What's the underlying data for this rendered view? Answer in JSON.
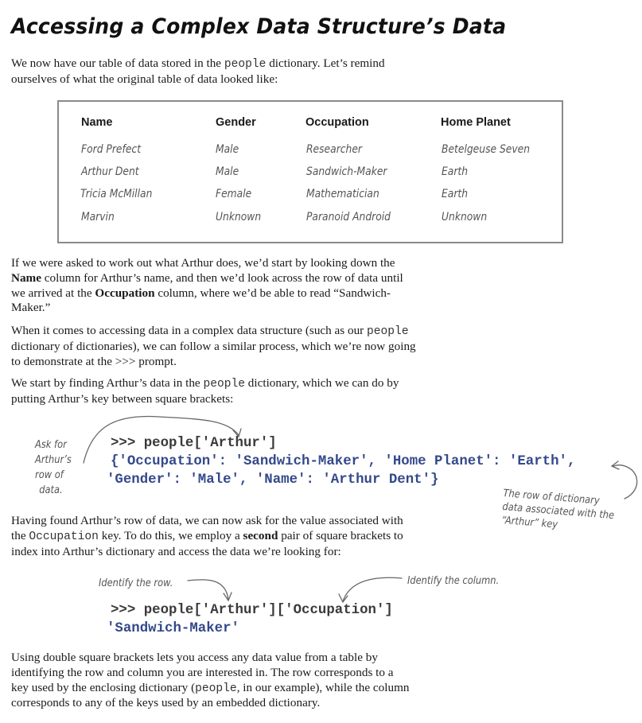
{
  "title": "Accessing a Complex Data Structure’s Data",
  "intro": {
    "p1_a": "We now have our table of data stored in the ",
    "p1_code": "people",
    "p1_b": " dictionary. Let’s remind",
    "p1_line2": "ourselves of what the original table of data looked like:"
  },
  "table": {
    "headers": [
      "Name",
      "Gender",
      "Occupation",
      "Home Planet"
    ],
    "rows": [
      [
        "Ford Prefect",
        "Male",
        "Researcher",
        "Betelgeuse Seven"
      ],
      [
        "Arthur Dent",
        "Male",
        "Sandwich-Maker",
        "Earth"
      ],
      [
        "Tricia McMillan",
        "Female",
        "Mathematician",
        "Earth"
      ],
      [
        "Marvin",
        "Unknown",
        "Paranoid Android",
        "Unknown"
      ]
    ]
  },
  "para2": {
    "l1": "If we were asked to work out what Arthur does, we’d start by looking down the",
    "l2_bold": "Name",
    "l2_rest": " column for Arthur’s name, and then we’d look across the row of data until",
    "l3_a": "we arrived at the ",
    "l3_bold": "Occupation",
    "l3_b": " column, where we’d be able to read “Sandwich-",
    "l4": "Maker.”"
  },
  "para3": {
    "l1_a": "When it comes to accessing data in a complex data structure (such as our ",
    "l1_code": "people",
    "l2": "dictionary of dictionaries), we can follow a similar process, which we’re now going",
    "l3": "to demonstrate at the >>> prompt."
  },
  "para4": {
    "l1_a": "We start by finding Arthur’s data in the ",
    "l1_code": "people",
    "l1_b": " dictionary, which we can do by",
    "l2": "putting Arthur’s key between square brackets:"
  },
  "code1": {
    "prompt": ">>> people['Arthur']",
    "out1": "{'Occupation': 'Sandwich-Maker', 'Home Planet': 'Earth',",
    "out2": "'Gender': 'Male', 'Name': 'Arthur Dent'}"
  },
  "notes1": {
    "left": [
      "Ask for",
      "Arthur’s",
      "row of",
      "data."
    ],
    "right": [
      "The row of dictionary",
      "data associated with the",
      "“Arthur” key"
    ]
  },
  "para5": {
    "l1": "Having found Arthur’s row of data, we can now ask for the value associated with",
    "l2_a": "the ",
    "l2_code": "Occupation",
    "l2_b": " key. To do this, we employ a ",
    "l2_bold": "second",
    "l2_c": " pair of square brackets to",
    "l3": "index into Arthur’s dictionary and access the data we’re looking for:"
  },
  "notes2": {
    "row": "Identify the row.",
    "col": "Identify the column."
  },
  "code2": {
    "prompt": ">>> people['Arthur']['Occupation']",
    "out": "'Sandwich-Maker'"
  },
  "para6": {
    "l1": "Using double square brackets lets you access any data value from a table by",
    "l2": "identifying the row and column you are interested in. The row corresponds to a",
    "l3_a": "key used by the enclosing dictionary (",
    "l3_code": "people",
    "l3_b": ", in our example), while the column",
    "l4": "corresponds to any of the keys used by an embedded dictionary."
  }
}
